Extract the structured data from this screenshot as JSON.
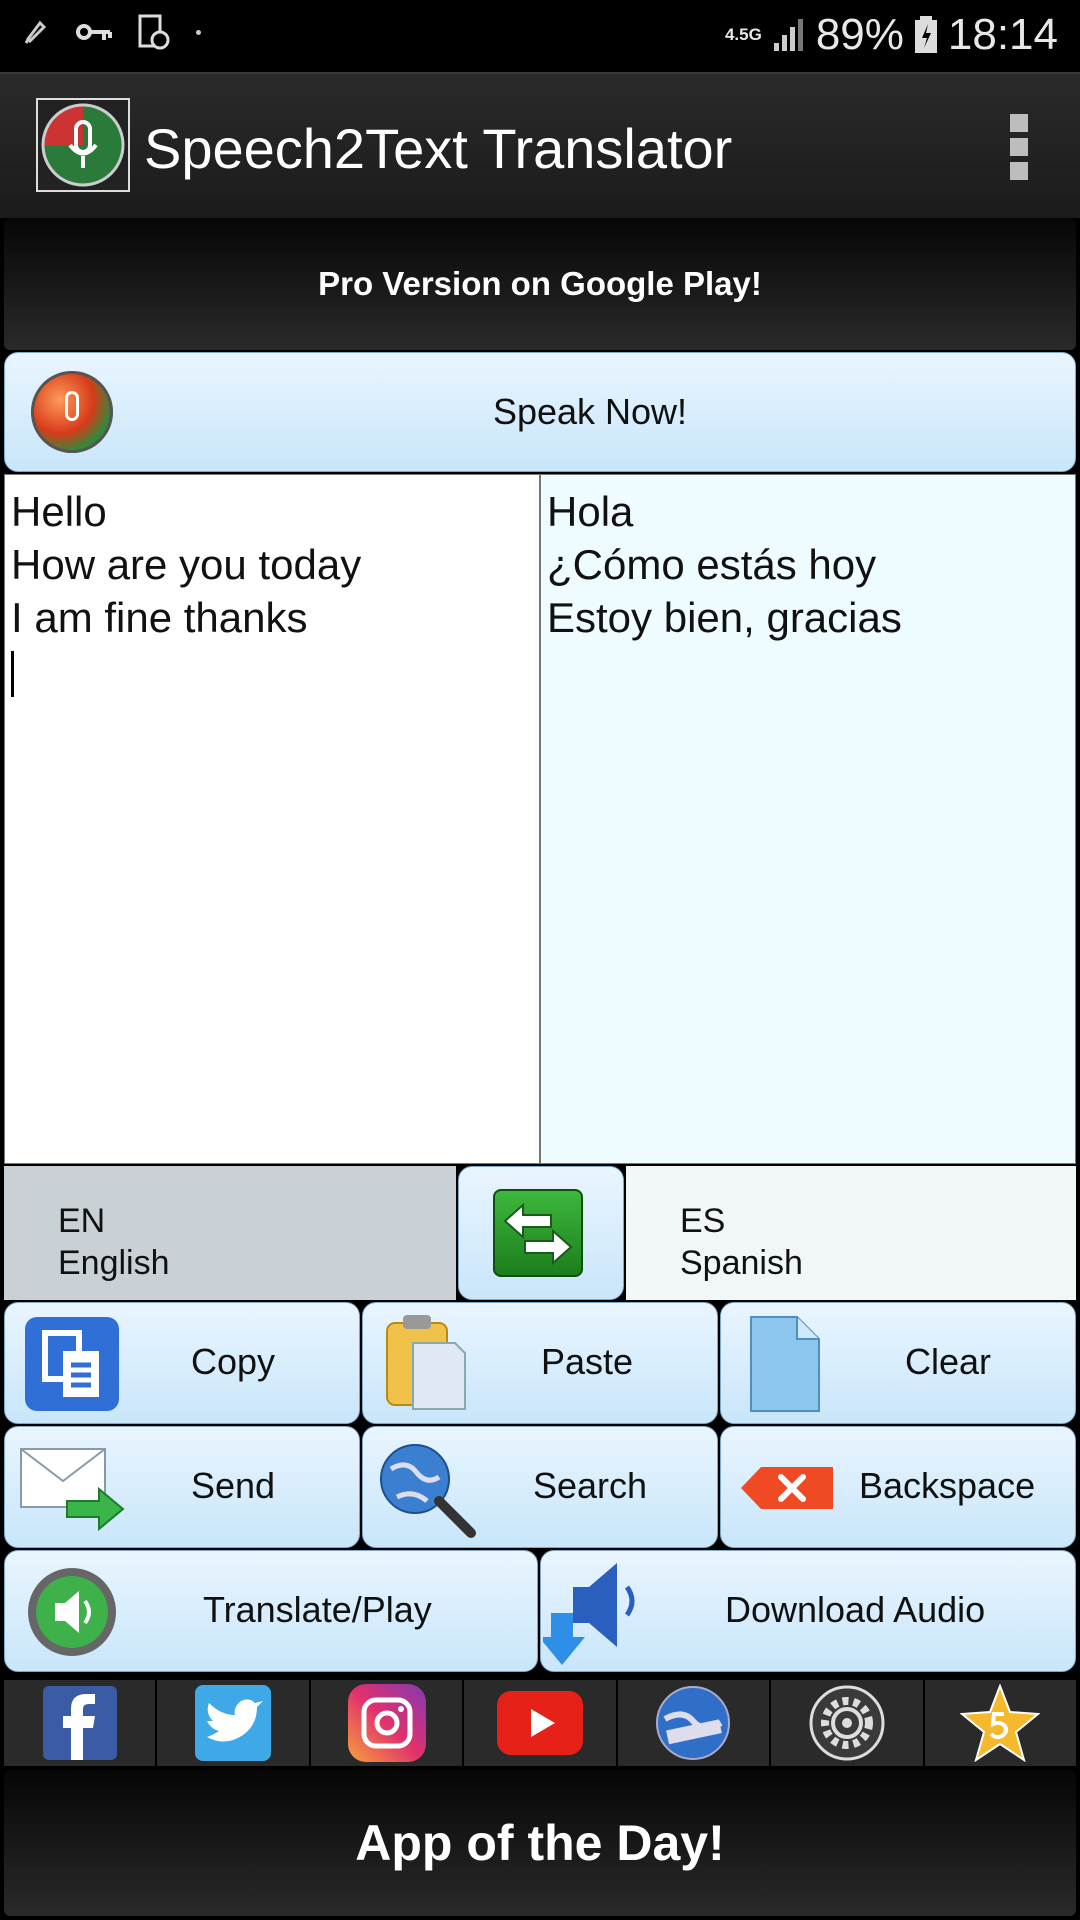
{
  "status_bar": {
    "network": "4.5G",
    "battery": "89%",
    "time": "18:14"
  },
  "app_bar": {
    "title": "Speech2Text Translator"
  },
  "pro_banner": "Pro Version on Google Play!",
  "speak_button": "Speak Now!",
  "source_text": {
    "line1": "Hello",
    "line2": "How are you today",
    "line3": "I am fine thanks"
  },
  "translated_text": {
    "line1": "Hola",
    "line2": "¿Cómo estás hoy",
    "line3": "Estoy bien, gracias"
  },
  "languages": {
    "from_code": "EN",
    "from_name": "English",
    "to_code": "ES",
    "to_name": "Spanish"
  },
  "buttons": {
    "copy": "Copy",
    "paste": "Paste",
    "clear": "Clear",
    "send": "Send",
    "search": "Search",
    "backspace": "Backspace",
    "translate_play": "Translate/Play",
    "download_audio": "Download Audio"
  },
  "bottom_banner": "App of the Day!",
  "colors": {
    "button_bg": "#d6ecfb",
    "source_pane_bg": "#ffffff",
    "target_pane_bg": "#effcff",
    "from_lang_bg": "#c9d1d6"
  },
  "social_icons": [
    "facebook-icon",
    "twitter-icon",
    "instagram-icon",
    "youtube-icon",
    "web-icon",
    "settings-icon",
    "rate-star-icon"
  ]
}
